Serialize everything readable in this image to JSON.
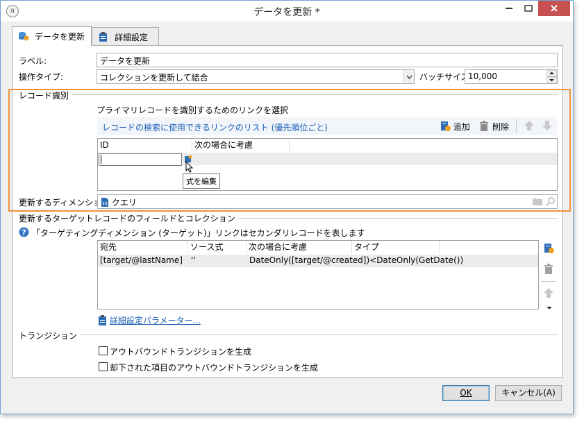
{
  "window": {
    "title": "データを更新 *"
  },
  "tabs": [
    {
      "label": "データを更新"
    },
    {
      "label": "詳細設定"
    }
  ],
  "form": {
    "label_caption": "ラベル:",
    "label_value": "データを更新",
    "operation_caption": "操作タイプ:",
    "operation_value": "コレクションを更新して結合",
    "batch_caption": "バッチサイズ:",
    "batch_value": "10,000"
  },
  "record_id": {
    "section_title": "レコード識別",
    "instruction": "プライマリレコードを識別するためのリンクを選択",
    "list_caption": "レコードの検索に使用できるリンクのリスト (優先順位ごと)",
    "add_label": "追加",
    "delete_label": "削除",
    "columns": [
      "ID",
      "次の場合に考慮"
    ],
    "tooltip": "式を編集",
    "dimension_caption": "更新するディメンション:",
    "dimension_value": "クエリ"
  },
  "fields": {
    "section_title": "更新するターゲットレコードのフィールドとコレクション",
    "help_text": "「ターゲティングディメンション (ターゲット)」リンクはセカンダリレコードを表します",
    "columns": [
      "宛先",
      "ソース式",
      "次の場合に考慮",
      "タイプ"
    ],
    "rows": [
      {
        "dest": "[target/@lastName]",
        "source": "''",
        "condition": "DateOnly([target/@created])<DateOnly(GetDate())",
        "type": ""
      }
    ],
    "advanced_link": "詳細設定パラメーター..."
  },
  "transitions": {
    "section_title": "トランジション",
    "option1": "アウトバウンドトランジションを生成",
    "option2": "却下された項目のアウトバウンドトランジションを生成"
  },
  "buttons": {
    "ok": "OK",
    "cancel": "キャンセル(A)"
  },
  "colors": {
    "highlight": "#f0913b",
    "link": "#1a5fb4",
    "close": "#c75050"
  }
}
